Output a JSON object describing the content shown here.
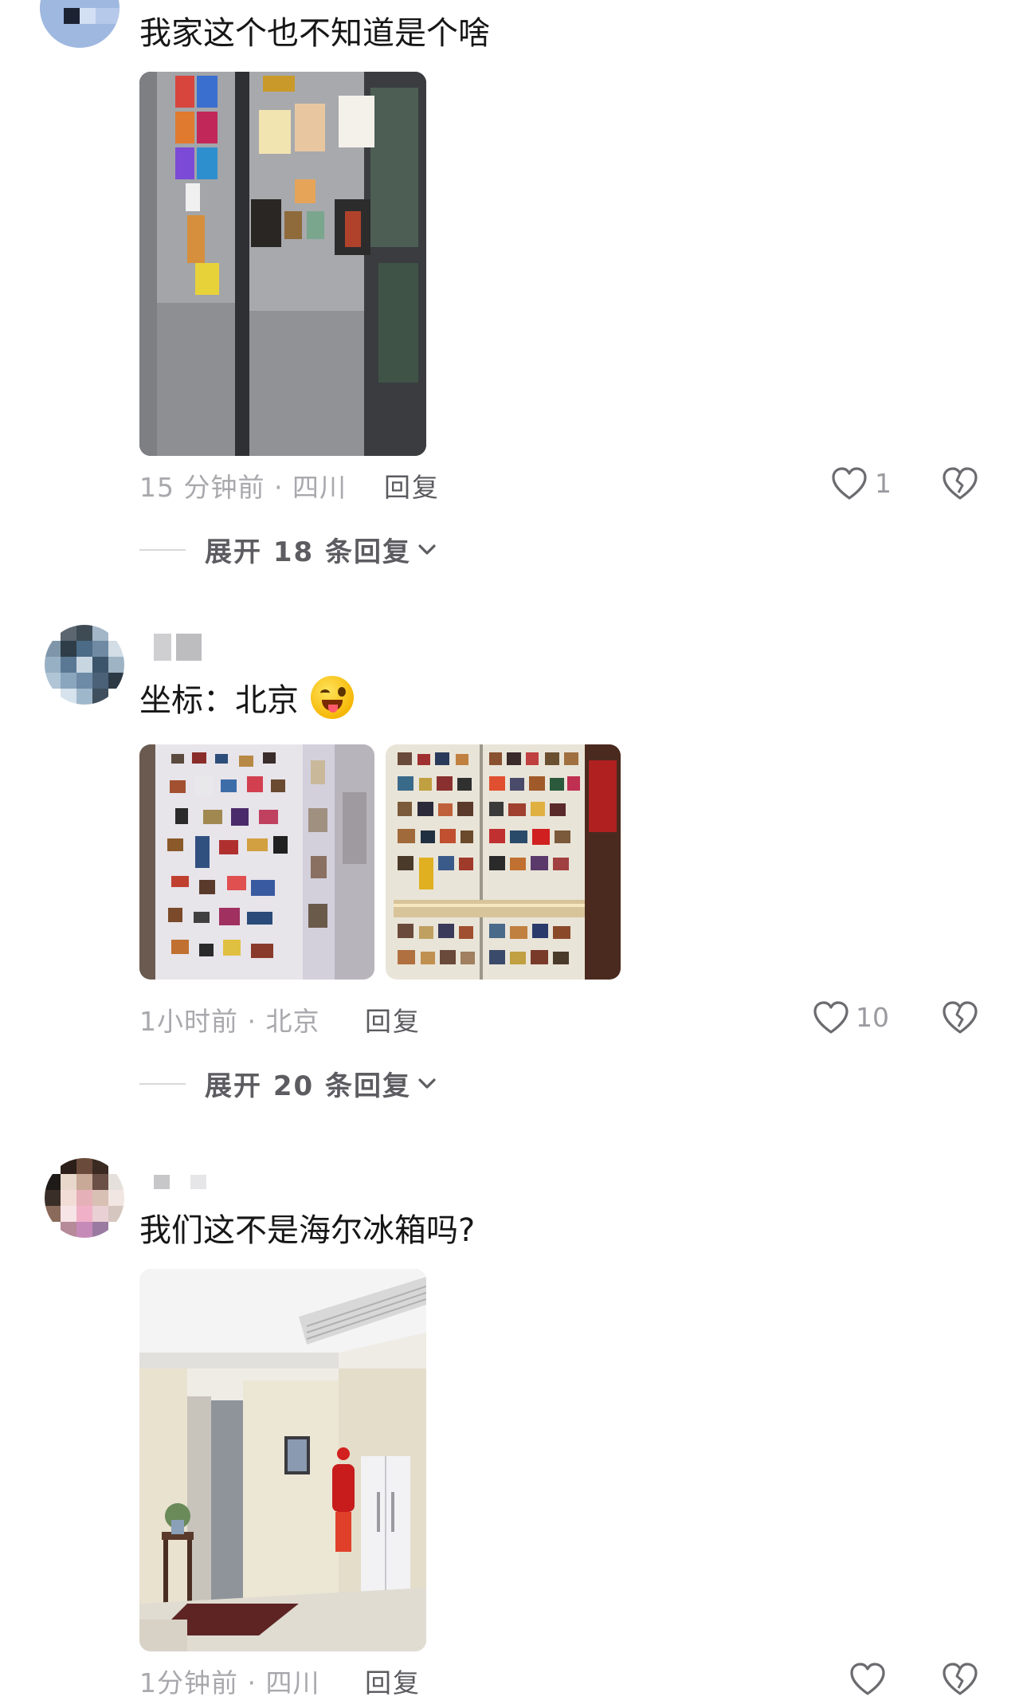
{
  "comments": [
    {
      "text": "我家这个也不知道是个啥",
      "meta": "15 分钟前 · 四川",
      "reply_label": "回复",
      "likes": "1",
      "expand": {
        "text": "展开 18 条回复"
      }
    },
    {
      "text": "坐标：北京",
      "meta": "1小时前 · 北京",
      "reply_label": "回复",
      "likes": "10",
      "expand": {
        "text": "展开 20 条回复"
      }
    },
    {
      "text": "我们这不是海尔冰箱吗?",
      "meta": "1分钟前 · 四川",
      "reply_label": "回复",
      "likes": ""
    }
  ],
  "icons": {
    "like": "heart-icon",
    "dislike": "broken-heart-icon",
    "expand": "chevron-down-icon"
  },
  "colors": {
    "meta_text": "#a8a8ad",
    "reply_text": "#5b5b60",
    "expand_text": "#5c5c61",
    "icon_stroke": "#6b6b70"
  }
}
